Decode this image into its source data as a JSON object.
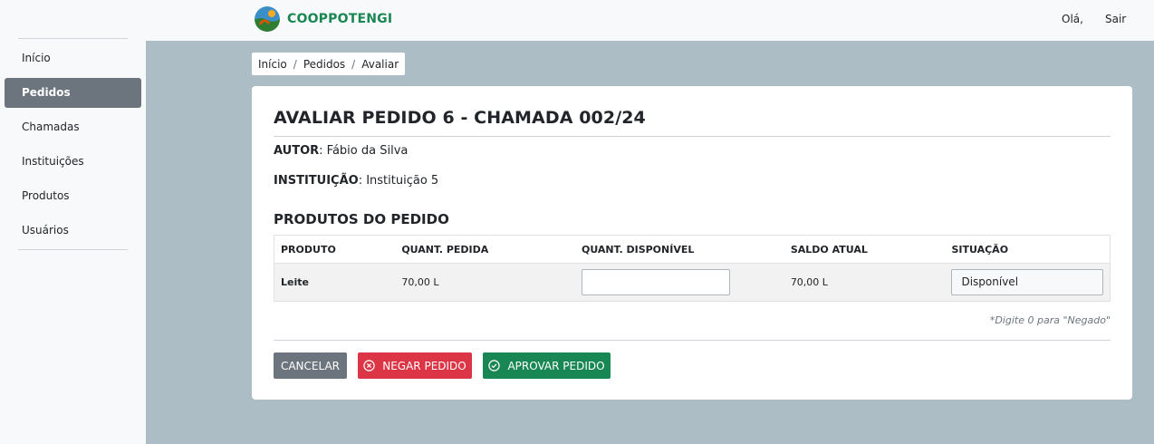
{
  "header": {
    "brand": "COOPPOTENGI",
    "greeting": "Olá,",
    "logout": "Sair"
  },
  "sidebar": {
    "items": [
      {
        "label": "Início"
      },
      {
        "label": "Pedidos",
        "active": true
      },
      {
        "label": "Chamadas"
      },
      {
        "label": "Instituições"
      },
      {
        "label": "Produtos"
      },
      {
        "label": "Usuários"
      }
    ]
  },
  "breadcrumb": [
    "Início",
    "Pedidos",
    "Avaliar"
  ],
  "page": {
    "title": "AVALIAR PEDIDO 6 - CHAMADA 002/24",
    "author_label": "AUTOR",
    "author_value": ": Fábio da Silva",
    "institution_label": "INSTITUIÇÃO",
    "institution_value": ": Instituição 5",
    "products_title": "PRODUTOS DO PEDIDO"
  },
  "table": {
    "headers": [
      "PRODUTO",
      "QUANT. PEDIDA",
      "QUANT. DISPONÍVEL",
      "SALDO ATUAL",
      "SITUAÇÃO"
    ],
    "rows": [
      {
        "product": "Leite",
        "requested": "70,00 L",
        "available": "",
        "balance": "70,00 L",
        "status": "Disponível"
      }
    ]
  },
  "hint": "*Digite 0 para \"Negado\"",
  "buttons": {
    "cancel": "CANCELAR",
    "deny": "NEGAR PEDIDO",
    "approve": "APROVAR PEDIDO"
  },
  "colors": {
    "brand": "#198754",
    "sidebar_active": "#6c757d",
    "main_bg": "#adbdc6",
    "deny": "#dc3545",
    "approve": "#198754",
    "cancel": "#6c757d"
  }
}
